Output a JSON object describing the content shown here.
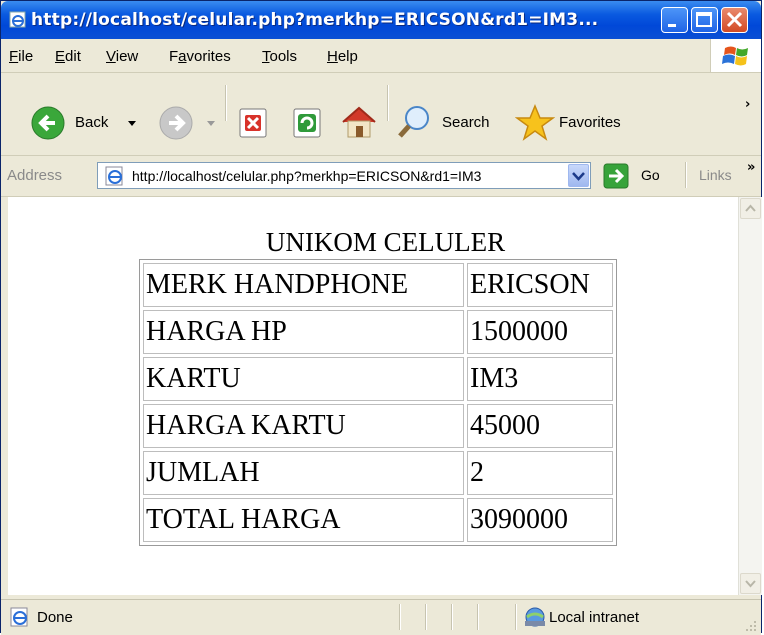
{
  "window": {
    "title": "http://localhost/celular.php?merkhp=ERICSON&rd1=IM3..."
  },
  "menu": {
    "items": [
      {
        "label": "File",
        "accel": "F",
        "rest": "ile"
      },
      {
        "label": "Edit",
        "accel": "E",
        "rest": "dit"
      },
      {
        "label": "View",
        "accel": "V",
        "rest": "iew"
      },
      {
        "label": "Favorites",
        "accel": "a",
        "pre": "F",
        "rest": "vorites"
      },
      {
        "label": "Tools",
        "accel": "T",
        "rest": "ools"
      },
      {
        "label": "Help",
        "accel": "H",
        "rest": "elp"
      }
    ]
  },
  "toolbar": {
    "back_label": "Back",
    "search_label": "Search",
    "favorites_label": "Favorites"
  },
  "address": {
    "label": "Address",
    "url": "http://localhost/celular.php?merkhp=ERICSON&rd1=IM3",
    "go_label": "Go",
    "links_label": "Links"
  },
  "page": {
    "title": "UNIKOM CELULER",
    "rows": [
      {
        "key": "MERK HANDPHONE",
        "value": "ERICSON"
      },
      {
        "key": "HARGA HP",
        "value": "1500000"
      },
      {
        "key": "KARTU",
        "value": "IM3"
      },
      {
        "key": "HARGA KARTU",
        "value": "45000"
      },
      {
        "key": "JUMLAH",
        "value": "2"
      },
      {
        "key": "TOTAL HARGA",
        "value": "3090000"
      }
    ]
  },
  "status": {
    "text": "Done",
    "zone": "Local intranet"
  }
}
